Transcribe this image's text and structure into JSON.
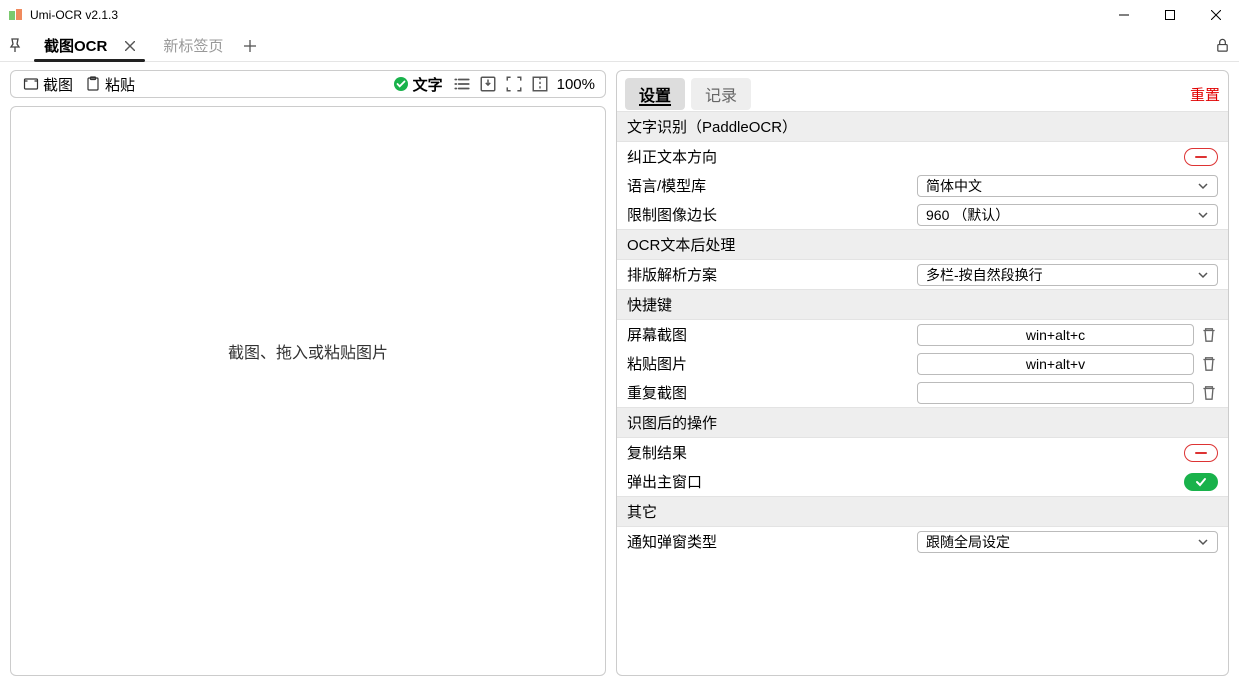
{
  "window": {
    "title": "Umi-OCR v2.1.3"
  },
  "tabs": {
    "active": "截图OCR",
    "inactive": "新标签页"
  },
  "left": {
    "screenshot": "截图",
    "paste": "粘贴",
    "textmode": "文字",
    "zoom": "100%",
    "dropmsg": "截图、拖入或粘贴图片"
  },
  "right": {
    "tabs": {
      "settings": "设置",
      "log": "记录"
    },
    "reset": "重置",
    "headers": {
      "engine": "文字识别（PaddleOCR）",
      "postproc": "OCR文本后处理",
      "hotkeys": "快捷键",
      "afterRec": "识图后的操作",
      "other": "其它"
    },
    "rows": {
      "correctDir": "纠正文本方向",
      "lang": "语言/模型库",
      "langVal": "简体中文",
      "limitEdge": "限制图像边长",
      "limitEdgeVal": "960 （默认）",
      "layout": "排版解析方案",
      "layoutVal": "多栏-按自然段换行",
      "hkScreenshot": "屏幕截图",
      "hkScreenshotVal": "win+alt+c",
      "hkPaste": "粘贴图片",
      "hkPasteVal": "win+alt+v",
      "hkRepeat": "重复截图",
      "hkRepeatVal": "",
      "copyResult": "复制结果",
      "popup": "弹出主窗口",
      "notifyType": "通知弹窗类型",
      "notifyTypeVal": "跟随全局设定"
    }
  }
}
